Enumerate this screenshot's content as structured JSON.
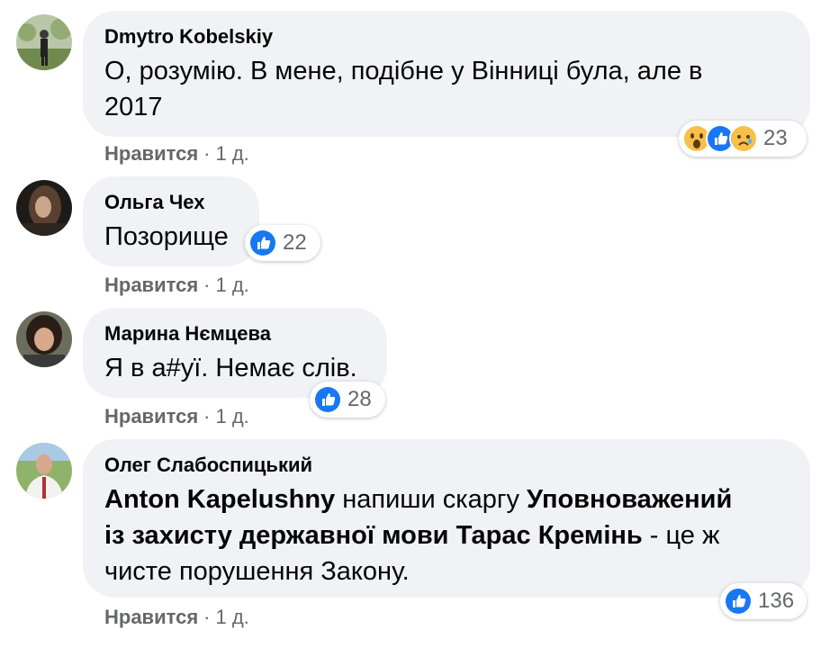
{
  "comments": [
    {
      "author": "Dmytro Kobelskiy",
      "text_line1": "О, розумію. В мене, подібне у Вінниці була, але в",
      "text_line2": "2017",
      "reactions": [
        "wow",
        "like",
        "sad"
      ],
      "reaction_count": "23",
      "like_label": "Нравится",
      "separator": "·",
      "time": "1 д."
    },
    {
      "author": "Ольга Чех",
      "text": "Позорище",
      "reactions": [
        "like"
      ],
      "reaction_count": "22",
      "like_label": "Нравится",
      "separator": "·",
      "time": "1 д."
    },
    {
      "author": "Марина Нємцева",
      "text": "Я в а#уї. Немає слів.",
      "reactions": [
        "like"
      ],
      "reaction_count": "28",
      "like_label": "Нравится",
      "separator": "·",
      "time": "1 д."
    },
    {
      "author": "Олег Слабоспицький",
      "mention": "Anton Kapelushny",
      "text_a": " напиши скаргу ",
      "bold_a": "Уповноважений",
      "bold_b": "із захисту державної мови Тарас Кремінь",
      "text_b": " - це ж",
      "text_c": "чисте порушення Закону.",
      "reactions": [
        "like"
      ],
      "reaction_count": "136",
      "like_label": "Нравится",
      "separator": "·",
      "time": "1 д."
    }
  ],
  "colors": {
    "bubble_bg": "#f0f2f5",
    "like_blue": "#1877f2",
    "meta_gray": "#65676b",
    "wow_yellow": "#f7c04a"
  }
}
